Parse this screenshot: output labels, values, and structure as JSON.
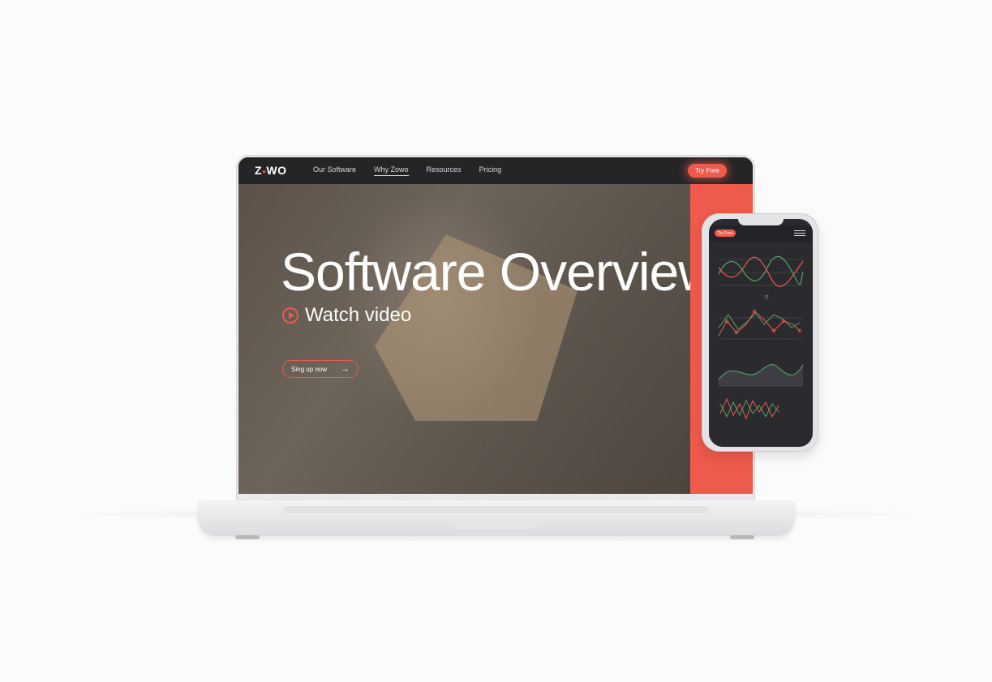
{
  "brand": {
    "logo_text": "Z",
    "logo_tail": "WO"
  },
  "nav": {
    "links": [
      {
        "label": "Our Software"
      },
      {
        "label": "Why Zowo"
      },
      {
        "label": "Resources"
      },
      {
        "label": "Pricing"
      }
    ],
    "active_link": "Why Zowo",
    "cta_label": "Try Free"
  },
  "hero": {
    "title": "Software Overview",
    "watch_label": "Watch video",
    "signup_label": "Sing up now"
  },
  "mobile": {
    "cta_label": "Try Free"
  },
  "colors": {
    "accent": "#ee5a4b",
    "nav_bg": "#252527",
    "phone_bg": "#2b2b2f",
    "chart_red": "#ee5a4b",
    "chart_green": "#4fa36a"
  },
  "icons": [
    "play-icon",
    "arrow-right-icon",
    "hamburger-menu-icon"
  ]
}
